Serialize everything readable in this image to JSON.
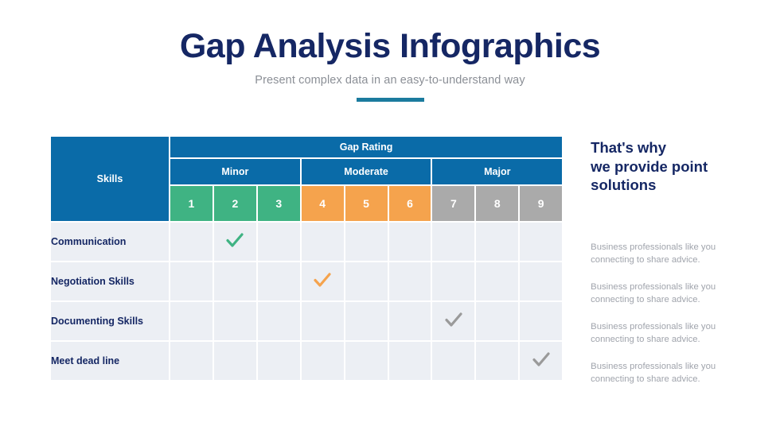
{
  "header": {
    "title": "Gap Analysis Infographics",
    "subtitle": "Present complex data in an easy-to-understand way"
  },
  "colors": {
    "navy": "#152764",
    "header_blue": "#0a6ba8",
    "accent_rule": "#1b7b9e",
    "minor_green": "#3fb383",
    "moderate_orange": "#f5a34d",
    "major_gray": "#aaaaaa",
    "cell_bg": "#eceff4",
    "subtitle_gray": "#8b8f96",
    "note_gray": "#a0a4ac"
  },
  "table": {
    "skills_header": "Skills",
    "gap_rating_header": "Gap Rating",
    "bands": [
      {
        "label": "Minor",
        "numbers": [
          "1",
          "2",
          "3"
        ],
        "style": "green"
      },
      {
        "label": "Moderate",
        "numbers": [
          "4",
          "5",
          "6"
        ],
        "style": "orange"
      },
      {
        "label": "Major",
        "numbers": [
          "7",
          "8",
          "9"
        ],
        "style": "gray"
      }
    ],
    "numbers": [
      "1",
      "2",
      "3",
      "4",
      "5",
      "6",
      "7",
      "8",
      "9"
    ],
    "rows": [
      {
        "skill": "Communication",
        "rating": 2,
        "mark_color": "#3fb383"
      },
      {
        "skill": "Negotiation Skills",
        "rating": 4,
        "mark_color": "#f5a34d"
      },
      {
        "skill": "Documenting Skills",
        "rating": 7,
        "mark_color": "#9a9a9a"
      },
      {
        "skill": "Meet dead line",
        "rating": 9,
        "mark_color": "#9a9a9a"
      }
    ]
  },
  "side": {
    "heading": "That's why\nwe provide point\nsolutions",
    "notes": [
      "Business professionals like you\nconnecting to share advice.",
      "Business professionals like you\nconnecting to share advice.",
      "Business professionals like you\nconnecting to share advice.",
      "Business professionals like you\nconnecting to share advice."
    ]
  }
}
